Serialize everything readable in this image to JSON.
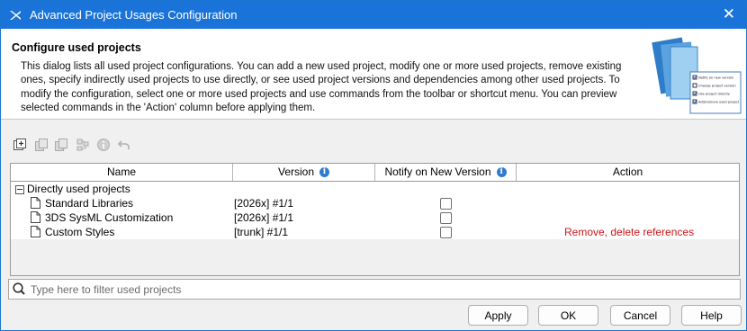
{
  "window": {
    "title": "Advanced Project Usages Configuration",
    "close_glyph": "✕"
  },
  "header": {
    "title": "Configure used projects",
    "description": "This dialog lists all used project configurations. You can add a new used project, modify one or more used projects, remove existing ones, specify indirectly used projects to use directly, or see used project versions and dependencies among other used projects. To modify the configuration, select one or more used projects and use commands from the toolbar or shortcut menu. You can preview selected commands in the 'Action' column before applying them.",
    "art_labels": [
      "Notify on new version",
      "Change project version",
      "Use project directly",
      "Add/remove used project"
    ]
  },
  "toolbar": {
    "icons": [
      "add-used-project-icon",
      "use-directly-icon",
      "change-version-icon",
      "dependencies-icon",
      "info-icon",
      "undo-icon"
    ]
  },
  "table": {
    "columns": {
      "name": "Name",
      "version": "Version",
      "notify": "Notify on New Version",
      "action": "Action"
    },
    "group": {
      "label": "Directly used projects"
    },
    "rows": [
      {
        "name": "Standard Libraries",
        "version": "[2026x] #1/1",
        "notify": false,
        "action": ""
      },
      {
        "name": "3DS SysML Customization",
        "version": "[2026x] #1/1",
        "notify": false,
        "action": ""
      },
      {
        "name": "Custom Styles",
        "version": "[trunk] #1/1",
        "notify": false,
        "action": "Remove, delete references"
      }
    ]
  },
  "filter": {
    "placeholder": "Type here to filter used projects",
    "value": ""
  },
  "buttons": {
    "apply": "Apply",
    "ok": "OK",
    "cancel": "Cancel",
    "help": "Help"
  },
  "colors": {
    "titlebar": "#1a73d9",
    "action_text": "#d0181c",
    "info": "#2f7bd0"
  }
}
